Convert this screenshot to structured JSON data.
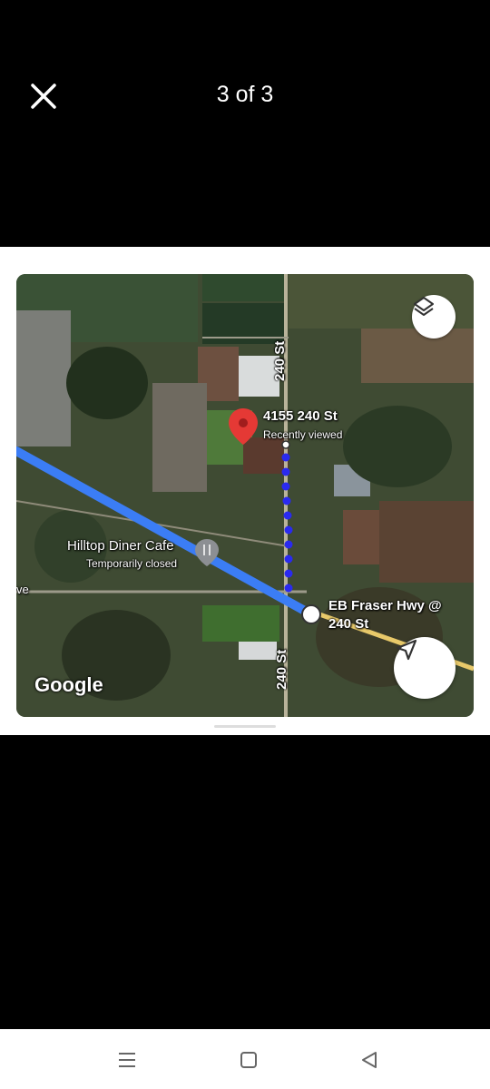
{
  "viewer": {
    "counter": "3 of 3",
    "close_icon": "close-icon"
  },
  "map": {
    "street_label_top": "240 St",
    "street_label_bottom": "240 St",
    "pin_address": "4155 240 St",
    "pin_status": "Recently viewed",
    "restaurant_name": "Hilltop Diner Cafe",
    "restaurant_status": "Temporarily closed",
    "edge_label": "ve",
    "stop_name_line1": "EB Fraser Hwy @",
    "stop_name_line2": "240 St",
    "attribution": "Google",
    "colors": {
      "route": "#3b7df5",
      "walking_dots": "#2a2af0",
      "pin": "#e53935",
      "road": "#e8c96a"
    }
  },
  "system_nav": {
    "menu_icon": "menu-icon",
    "home_icon": "home-icon",
    "back_icon": "back-icon"
  }
}
